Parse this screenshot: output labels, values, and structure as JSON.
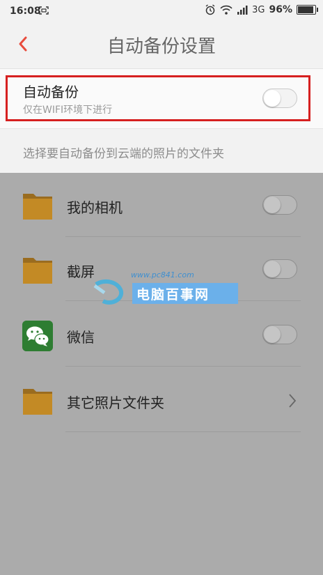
{
  "status_bar": {
    "time": "16:08",
    "network": "3G",
    "battery": "96%"
  },
  "header": {
    "title": "自动备份设置"
  },
  "auto_backup": {
    "title": "自动备份",
    "subtitle": "仅在WIFI环境下进行",
    "enabled": false
  },
  "section_label": "选择要自动备份到云端的照片的文件夹",
  "folders": [
    {
      "label": "我的相机",
      "icon": "folder-icon",
      "enabled": false
    },
    {
      "label": "截屏",
      "icon": "folder-icon",
      "enabled": false
    },
    {
      "label": "微信",
      "icon": "wechat-icon",
      "enabled": false
    },
    {
      "label": "其它照片文件夹",
      "icon": "folder-icon"
    }
  ],
  "watermark": {
    "url": "www.pc841.com",
    "text": "电脑百事网"
  },
  "colors": {
    "accent": "#e84c3d",
    "highlight_border": "#d62020",
    "folder": "#c38a25",
    "overlay": "#ababab"
  }
}
